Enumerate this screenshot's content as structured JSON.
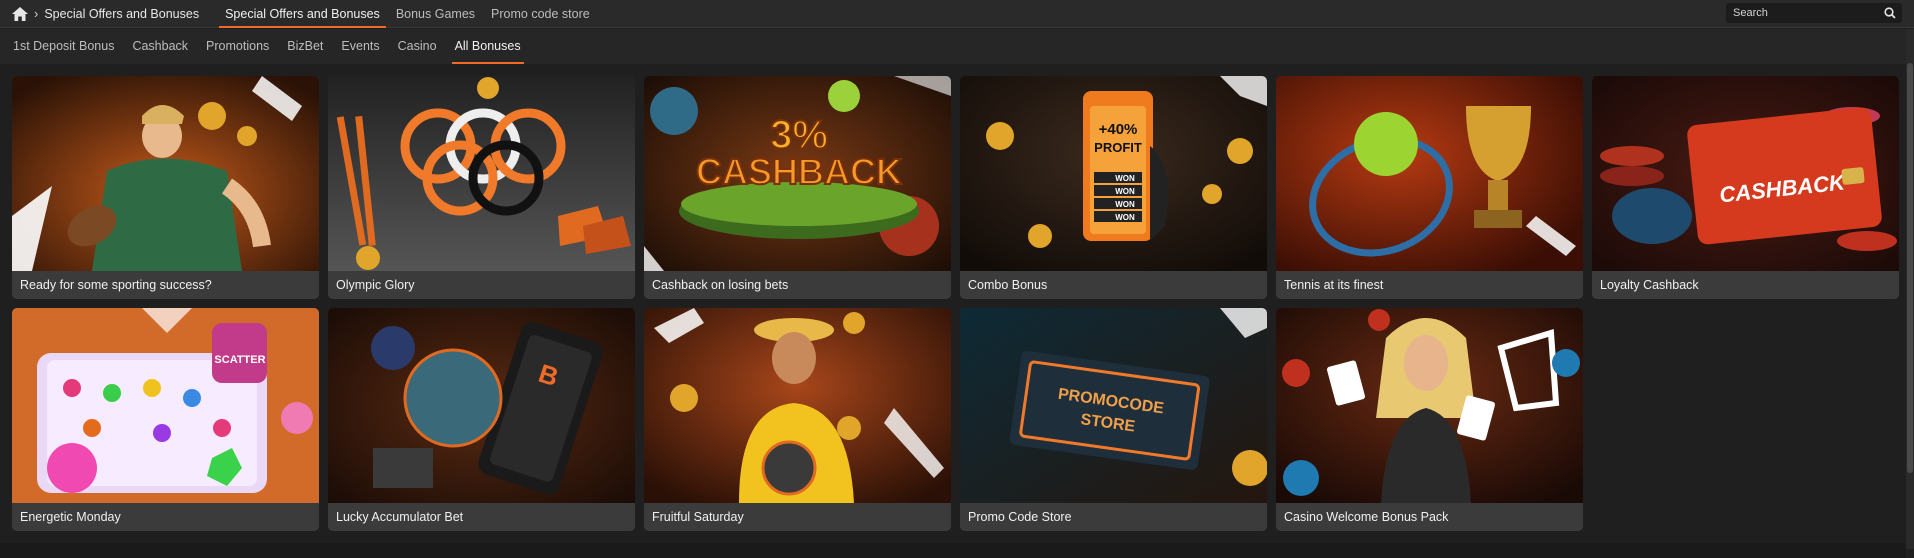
{
  "breadcrumb": {
    "current": "Special Offers and Bonuses"
  },
  "top_tabs": [
    {
      "label": "Special Offers and Bonuses",
      "active": true
    },
    {
      "label": "Bonus Games",
      "active": false
    },
    {
      "label": "Promo code store",
      "active": false
    }
  ],
  "search": {
    "placeholder": "Search"
  },
  "sub_tabs": [
    {
      "label": "1st Deposit Bonus",
      "active": false
    },
    {
      "label": "Cashback",
      "active": false
    },
    {
      "label": "Promotions",
      "active": false
    },
    {
      "label": "BizBet",
      "active": false
    },
    {
      "label": "Events",
      "active": false
    },
    {
      "label": "Casino",
      "active": false
    },
    {
      "label": "All Bonuses",
      "active": true
    }
  ],
  "cards": [
    {
      "title": "Ready for some sporting success?",
      "art": "rugby-player-image"
    },
    {
      "title": "Olympic Glory",
      "art": "olympic-rings-image"
    },
    {
      "title": "Cashback on losing bets",
      "art": "cashback-3-percent-image",
      "art_text": [
        "3%",
        "CASHBACK"
      ]
    },
    {
      "title": "Combo Bonus",
      "art": "combo-phone-image",
      "art_text": [
        "+40%",
        "PROFIT",
        "WON",
        "WON",
        "WON",
        "WON"
      ]
    },
    {
      "title": "Tennis at its finest",
      "art": "tennis-trophy-image"
    },
    {
      "title": "Loyalty Cashback",
      "art": "loyalty-card-image",
      "art_text": [
        "CASHBACK"
      ]
    },
    {
      "title": "Energetic Monday",
      "art": "slot-candy-image",
      "art_text": [
        "SCATTER"
      ]
    },
    {
      "title": "Lucky Accumulator Bet",
      "art": "football-phone-image"
    },
    {
      "title": "Fruitful Saturday",
      "art": "happy-man-image"
    },
    {
      "title": "Promo Code Store",
      "art": "promocode-chip-image",
      "art_text": [
        "PROMOCODE",
        "STORE"
      ]
    },
    {
      "title": "Casino Welcome Bonus Pack",
      "art": "casino-woman-image"
    }
  ],
  "colors": {
    "accent": "#f06a28",
    "background": "#1f1f1f",
    "card": "#3b3b3b"
  }
}
